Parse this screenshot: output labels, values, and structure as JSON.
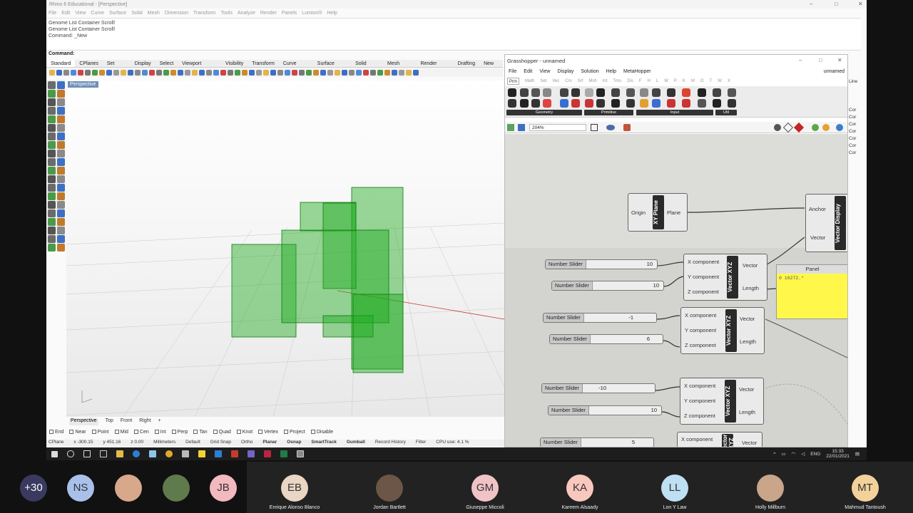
{
  "rhino": {
    "title": "Rhino 6 Educational - [Perspective]",
    "menu": [
      "File",
      "Edit",
      "View",
      "Curve",
      "Surface",
      "Solid",
      "Mesh",
      "Dimension",
      "Transform",
      "Tools",
      "Analyze",
      "Render",
      "Panels",
      "Lumion®",
      "Help"
    ],
    "history": [
      "Genome List Container Scroll!",
      "Genome List Container Scroll!",
      "Command: _New"
    ],
    "command_label": "Command:",
    "toolbar_tabs": [
      "Standard",
      "CPlanes",
      "Set View",
      "Display",
      "Select",
      "Viewport Layout",
      "Visibility",
      "Transform",
      "Curve Tools",
      "Surface Tools",
      "Solid Tools",
      "Mesh Tools",
      "Render Tools",
      "Drafting",
      "New in"
    ],
    "viewport_label": "Perspective",
    "viewport_tabs": [
      "Perspective",
      "Top",
      "Front",
      "Right",
      "+"
    ],
    "osnaps": [
      "End",
      "Near",
      "Point",
      "Mid",
      "Cen",
      "Int",
      "Perp",
      "Tan",
      "Quad",
      "Knot",
      "Vertex",
      "Project",
      "Disable"
    ],
    "status": {
      "cplane": "CPlane",
      "x": "x -300.15",
      "y": "y 451.16",
      "z": "z 0.00",
      "units": "Millimeters",
      "layer": "Default",
      "grid_snap": "Grid Snap",
      "ortho": "Ortho",
      "planar": "Planar",
      "osnap": "Osnap",
      "smarttrack": "SmartTrack",
      "gumball": "Gumball",
      "record": "Record History",
      "filter": "Filter",
      "cpu": "CPU use: 4.1 %"
    },
    "right_panel": [
      "Line",
      "",
      "",
      "",
      "Cor",
      "Cor",
      "Cor",
      "Cor",
      "Cor",
      "Cor",
      "Cor"
    ]
  },
  "gh": {
    "title": "Grasshopper - unnamed",
    "menu": [
      "File",
      "Edit",
      "View",
      "Display",
      "Solution",
      "Help",
      "MetaHopper"
    ],
    "doc_name": "unnamed",
    "tabs": [
      "Prm",
      "Math",
      "Set",
      "Vec",
      "Crv",
      "Srf",
      "Msh",
      "Int",
      "Trns",
      "Dis",
      "F",
      "H",
      "L",
      "W",
      "P",
      "K",
      "M",
      "O",
      "T",
      "W",
      "X"
    ],
    "groups": [
      "Geometry",
      "Primitive",
      "Input",
      "Util"
    ],
    "zoom": "204%",
    "xy_plane": {
      "nick": "XY Plane",
      "in": "Origin",
      "out": "Plane"
    },
    "vector_display": {
      "nick": "Vector Display",
      "in": [
        "Anchor",
        "Vector"
      ]
    },
    "vxyz": {
      "nick": "Vector XYZ",
      "inputs": [
        "X component",
        "Y component",
        "Z component"
      ],
      "outputs": [
        "Vector",
        "Length"
      ]
    },
    "sliders": [
      {
        "name": "Number Slider",
        "value": "10"
      },
      {
        "name": "Number Slider",
        "value": "10"
      },
      {
        "name": "Number Slider",
        "value": "-1"
      },
      {
        "name": "Number Slider",
        "value": "6"
      },
      {
        "name": "Number Slider",
        "value": "-10"
      },
      {
        "name": "Number Slider",
        "value": "10"
      },
      {
        "name": "Number Slider",
        "value": "5"
      }
    ],
    "panel": {
      "title": "Panel",
      "text": "0 16272.*"
    }
  },
  "taskbar": {
    "lang": "ENG",
    "time": "15:33",
    "date": "22/01/2021"
  },
  "participants": [
    {
      "initials": "+30",
      "name": "",
      "color": "#3a3a60",
      "fg": "#ffffff"
    },
    {
      "initials": "NS",
      "name": "",
      "color": "#a9c1ea",
      "fg": "#333333"
    },
    {
      "initials": "",
      "name": "",
      "color": "#d8a88a",
      "fg": "#333333"
    },
    {
      "initials": "",
      "name": "",
      "color": "#5f7a4d",
      "fg": "#333333"
    },
    {
      "initials": "JB",
      "name": "",
      "color": "#f2b9bf",
      "fg": "#333333"
    },
    {
      "initials": "EB",
      "name": "Enrique Alonso Blanco",
      "color": "#e9d6c3",
      "fg": "#333333"
    },
    {
      "initials": "",
      "name": "Jordan Bartlett",
      "color": "#6b5647",
      "fg": "#333333"
    },
    {
      "initials": "GM",
      "name": "Giuseppe Miccoli",
      "color": "#f0c4c6",
      "fg": "#333333"
    },
    {
      "initials": "KA",
      "name": "Kareem Alsaady",
      "color": "#f8c7bd",
      "fg": "#333333"
    },
    {
      "initials": "LL",
      "name": "Lon Y Law",
      "color": "#bfe0f2",
      "fg": "#333333"
    },
    {
      "initials": "",
      "name": "Holly Millburn",
      "color": "#c9a58a",
      "fg": "#333333"
    },
    {
      "initials": "MT",
      "name": "Mahmud Tantoush",
      "color": "#f3d19b",
      "fg": "#333333"
    }
  ]
}
